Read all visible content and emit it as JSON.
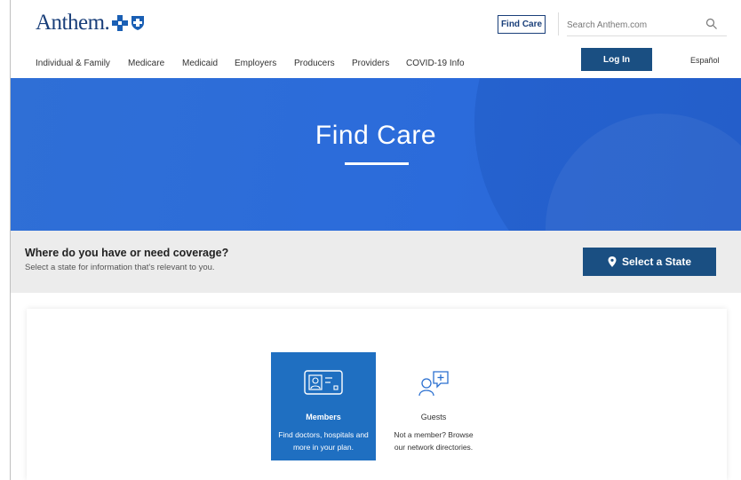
{
  "brand": {
    "name": "Anthem."
  },
  "header": {
    "find_care_label": "Find Care",
    "search_placeholder": "Search Anthem.com",
    "login_label": "Log In",
    "language_label": "Español",
    "nav": [
      "Individual & Family",
      "Medicare",
      "Medicaid",
      "Employers",
      "Producers",
      "Providers",
      "COVID-19 Info"
    ]
  },
  "hero": {
    "title": "Find Care"
  },
  "coverage": {
    "question": "Where do you have or need coverage?",
    "subtitle": "Select a state for information that's relevant to you.",
    "button_label": "Select a State"
  },
  "cards": {
    "members": {
      "title": "Members",
      "description": "Find doctors, hospitals and more in your plan."
    },
    "guests": {
      "title": "Guests",
      "description": "Not a member? Browse our network directories."
    }
  },
  "colors": {
    "brand_navy": "#1a3f7a",
    "button_blue": "#1a4f82",
    "hero_blue": "#2f6fd6",
    "card_blue": "#1f6fc1"
  },
  "icons": [
    "search-icon",
    "map-pin-icon",
    "id-card-icon",
    "chat-medical-icon",
    "blue-cross-icon",
    "blue-shield-icon"
  ]
}
